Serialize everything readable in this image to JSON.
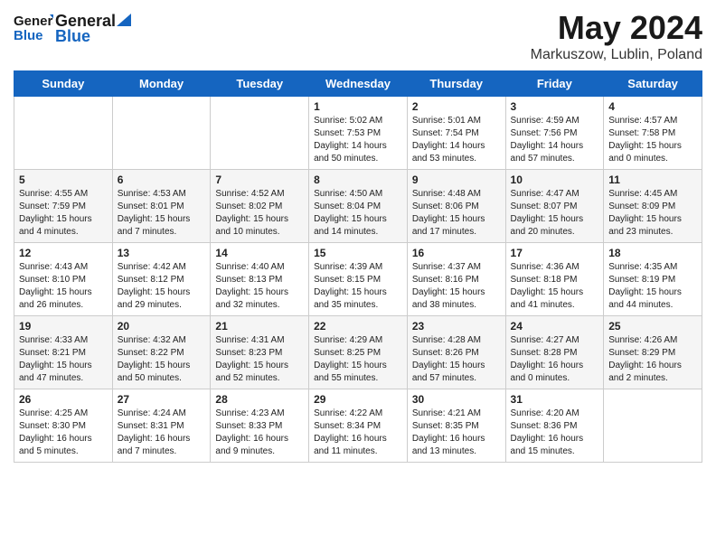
{
  "header": {
    "logo_general": "General",
    "logo_blue": "Blue",
    "title": "May 2024",
    "subtitle": "Markuszow, Lublin, Poland"
  },
  "days_of_week": [
    "Sunday",
    "Monday",
    "Tuesday",
    "Wednesday",
    "Thursday",
    "Friday",
    "Saturday"
  ],
  "weeks": [
    {
      "days": [
        {
          "num": "",
          "info": ""
        },
        {
          "num": "",
          "info": ""
        },
        {
          "num": "",
          "info": ""
        },
        {
          "num": "1",
          "info": "Sunrise: 5:02 AM\nSunset: 7:53 PM\nDaylight: 14 hours\nand 50 minutes."
        },
        {
          "num": "2",
          "info": "Sunrise: 5:01 AM\nSunset: 7:54 PM\nDaylight: 14 hours\nand 53 minutes."
        },
        {
          "num": "3",
          "info": "Sunrise: 4:59 AM\nSunset: 7:56 PM\nDaylight: 14 hours\nand 57 minutes."
        },
        {
          "num": "4",
          "info": "Sunrise: 4:57 AM\nSunset: 7:58 PM\nDaylight: 15 hours\nand 0 minutes."
        }
      ]
    },
    {
      "days": [
        {
          "num": "5",
          "info": "Sunrise: 4:55 AM\nSunset: 7:59 PM\nDaylight: 15 hours\nand 4 minutes."
        },
        {
          "num": "6",
          "info": "Sunrise: 4:53 AM\nSunset: 8:01 PM\nDaylight: 15 hours\nand 7 minutes."
        },
        {
          "num": "7",
          "info": "Sunrise: 4:52 AM\nSunset: 8:02 PM\nDaylight: 15 hours\nand 10 minutes."
        },
        {
          "num": "8",
          "info": "Sunrise: 4:50 AM\nSunset: 8:04 PM\nDaylight: 15 hours\nand 14 minutes."
        },
        {
          "num": "9",
          "info": "Sunrise: 4:48 AM\nSunset: 8:06 PM\nDaylight: 15 hours\nand 17 minutes."
        },
        {
          "num": "10",
          "info": "Sunrise: 4:47 AM\nSunset: 8:07 PM\nDaylight: 15 hours\nand 20 minutes."
        },
        {
          "num": "11",
          "info": "Sunrise: 4:45 AM\nSunset: 8:09 PM\nDaylight: 15 hours\nand 23 minutes."
        }
      ]
    },
    {
      "days": [
        {
          "num": "12",
          "info": "Sunrise: 4:43 AM\nSunset: 8:10 PM\nDaylight: 15 hours\nand 26 minutes."
        },
        {
          "num": "13",
          "info": "Sunrise: 4:42 AM\nSunset: 8:12 PM\nDaylight: 15 hours\nand 29 minutes."
        },
        {
          "num": "14",
          "info": "Sunrise: 4:40 AM\nSunset: 8:13 PM\nDaylight: 15 hours\nand 32 minutes."
        },
        {
          "num": "15",
          "info": "Sunrise: 4:39 AM\nSunset: 8:15 PM\nDaylight: 15 hours\nand 35 minutes."
        },
        {
          "num": "16",
          "info": "Sunrise: 4:37 AM\nSunset: 8:16 PM\nDaylight: 15 hours\nand 38 minutes."
        },
        {
          "num": "17",
          "info": "Sunrise: 4:36 AM\nSunset: 8:18 PM\nDaylight: 15 hours\nand 41 minutes."
        },
        {
          "num": "18",
          "info": "Sunrise: 4:35 AM\nSunset: 8:19 PM\nDaylight: 15 hours\nand 44 minutes."
        }
      ]
    },
    {
      "days": [
        {
          "num": "19",
          "info": "Sunrise: 4:33 AM\nSunset: 8:21 PM\nDaylight: 15 hours\nand 47 minutes."
        },
        {
          "num": "20",
          "info": "Sunrise: 4:32 AM\nSunset: 8:22 PM\nDaylight: 15 hours\nand 50 minutes."
        },
        {
          "num": "21",
          "info": "Sunrise: 4:31 AM\nSunset: 8:23 PM\nDaylight: 15 hours\nand 52 minutes."
        },
        {
          "num": "22",
          "info": "Sunrise: 4:29 AM\nSunset: 8:25 PM\nDaylight: 15 hours\nand 55 minutes."
        },
        {
          "num": "23",
          "info": "Sunrise: 4:28 AM\nSunset: 8:26 PM\nDaylight: 15 hours\nand 57 minutes."
        },
        {
          "num": "24",
          "info": "Sunrise: 4:27 AM\nSunset: 8:28 PM\nDaylight: 16 hours\nand 0 minutes."
        },
        {
          "num": "25",
          "info": "Sunrise: 4:26 AM\nSunset: 8:29 PM\nDaylight: 16 hours\nand 2 minutes."
        }
      ]
    },
    {
      "days": [
        {
          "num": "26",
          "info": "Sunrise: 4:25 AM\nSunset: 8:30 PM\nDaylight: 16 hours\nand 5 minutes."
        },
        {
          "num": "27",
          "info": "Sunrise: 4:24 AM\nSunset: 8:31 PM\nDaylight: 16 hours\nand 7 minutes."
        },
        {
          "num": "28",
          "info": "Sunrise: 4:23 AM\nSunset: 8:33 PM\nDaylight: 16 hours\nand 9 minutes."
        },
        {
          "num": "29",
          "info": "Sunrise: 4:22 AM\nSunset: 8:34 PM\nDaylight: 16 hours\nand 11 minutes."
        },
        {
          "num": "30",
          "info": "Sunrise: 4:21 AM\nSunset: 8:35 PM\nDaylight: 16 hours\nand 13 minutes."
        },
        {
          "num": "31",
          "info": "Sunrise: 4:20 AM\nSunset: 8:36 PM\nDaylight: 16 hours\nand 15 minutes."
        },
        {
          "num": "",
          "info": ""
        }
      ]
    }
  ]
}
